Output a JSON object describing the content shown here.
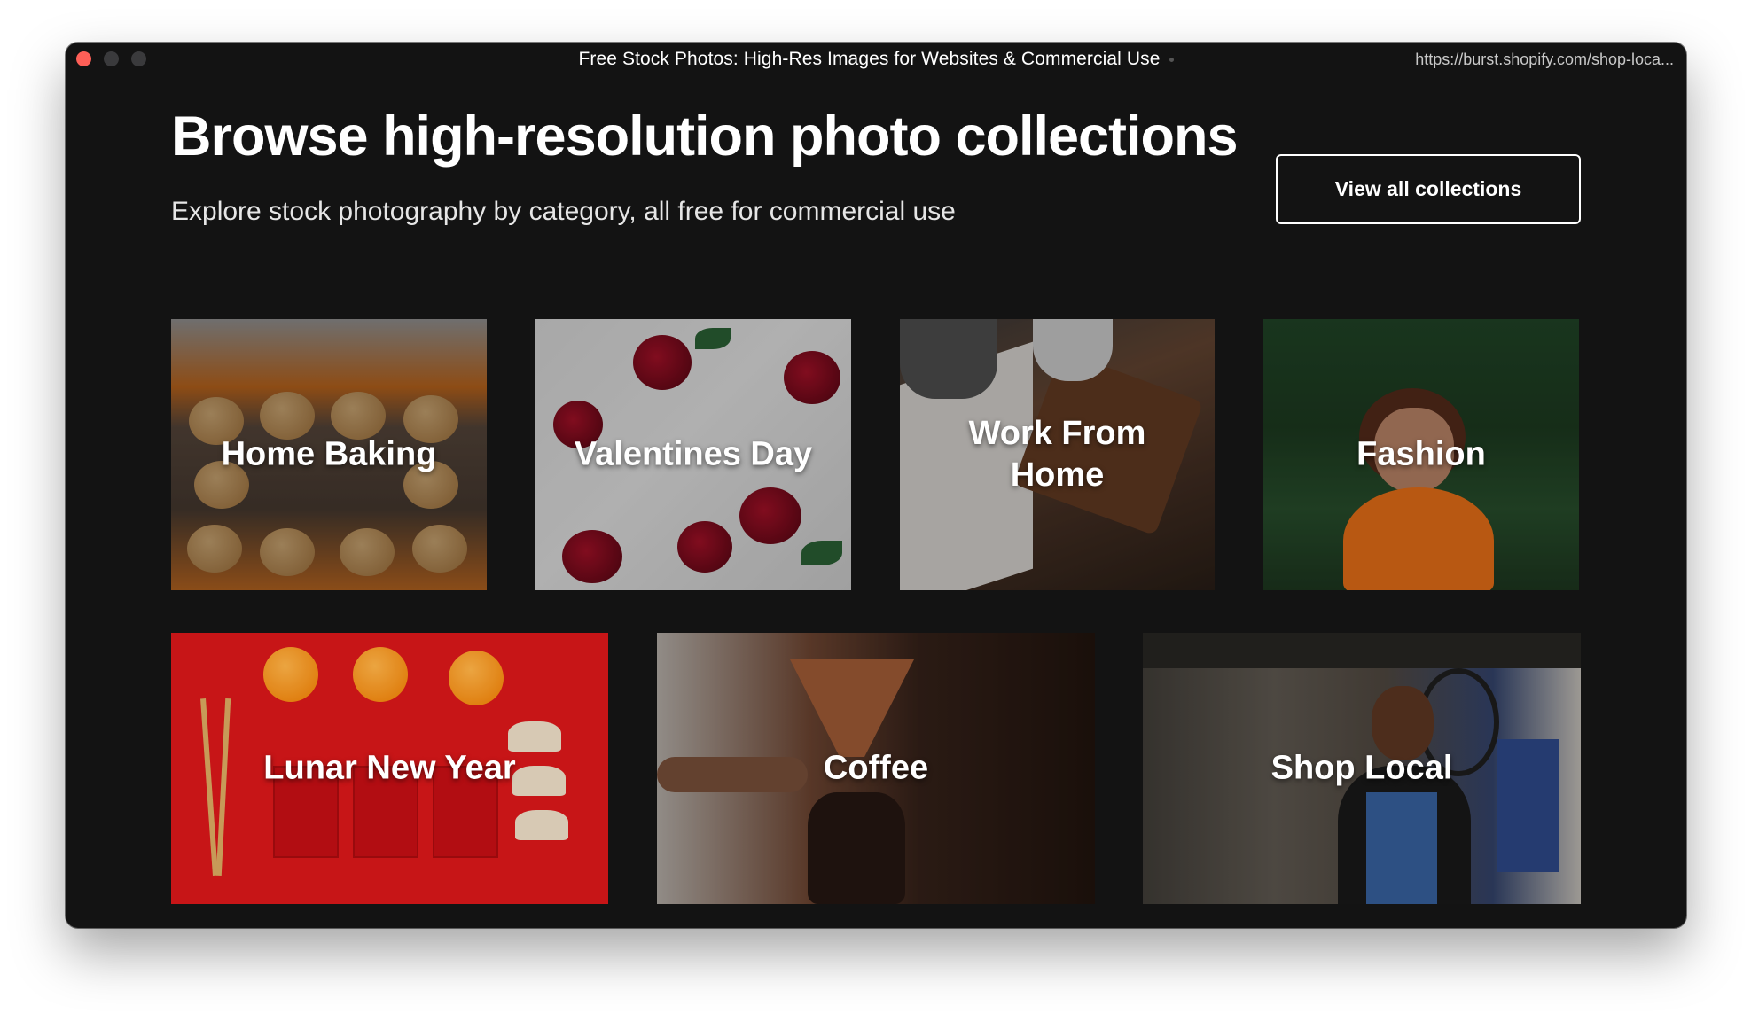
{
  "window": {
    "title": "Free Stock Photos: High-Res Images for Websites & Commercial Use",
    "url": "https://burst.shopify.com/shop-loca..."
  },
  "page": {
    "headline": "Browse high-resolution photo collections",
    "subheadline": "Explore stock photography by category, all free for commercial use",
    "view_all_label": "View all collections"
  },
  "collections": [
    {
      "label": "Home Baking"
    },
    {
      "label": "Valentines Day"
    },
    {
      "label": "Work From Home"
    },
    {
      "label": "Fashion"
    },
    {
      "label": "Lunar New Year"
    },
    {
      "label": "Coffee"
    },
    {
      "label": "Shop Local"
    }
  ],
  "colors": {
    "window_bg": "#131313",
    "text": "#ffffff",
    "close_button": "#fe5f57"
  }
}
